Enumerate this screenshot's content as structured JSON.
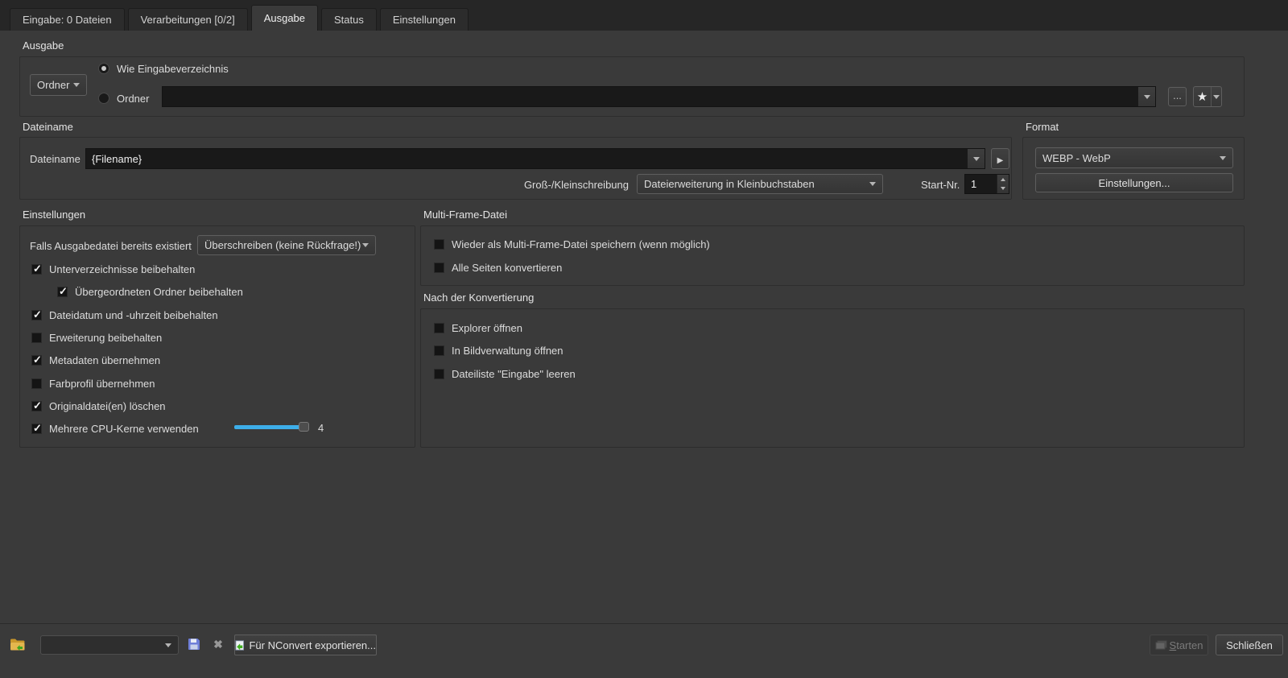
{
  "tabs": [
    {
      "label": "Eingabe: 0 Dateien"
    },
    {
      "label": "Verarbeitungen [0/2]"
    },
    {
      "label": "Ausgabe"
    },
    {
      "label": "Status"
    },
    {
      "label": "Einstellungen"
    }
  ],
  "active_tab": "Ausgabe",
  "ausgabe": {
    "title": "Ausgabe",
    "target_combo_value": "Ordner",
    "radio_same": {
      "label": "Wie Eingabeverzeichnis",
      "selected": true
    },
    "radio_folder": {
      "label": "Ordner",
      "selected": false
    },
    "folder_path_value": "",
    "browse_button": "..."
  },
  "dateiname": {
    "title": "Dateiname",
    "field_label": "Dateiname",
    "field_value": "{Filename}",
    "case_label": "Groß-/Kleinschreibung",
    "case_value": "Dateierweiterung in Kleinbuchstaben",
    "startnr_label": "Start-Nr.",
    "startnr_value": "1"
  },
  "format": {
    "title": "Format",
    "format_value": "WEBP - WebP",
    "settings_button": "Einstellungen..."
  },
  "einstellungen": {
    "title": "Einstellungen",
    "exists_label": "Falls Ausgabedatei bereits existiert",
    "exists_value": "Überschreiben (keine Rückfrage!)",
    "checkboxes": [
      {
        "label": "Unterverzeichnisse beibehalten",
        "checked": true
      },
      {
        "label": "Übergeordneten Ordner beibehalten",
        "checked": true
      },
      {
        "label": "Dateidatum und -uhrzeit beibehalten",
        "checked": true
      },
      {
        "label": "Erweiterung beibehalten",
        "checked": false
      },
      {
        "label": "Metadaten übernehmen",
        "checked": true
      },
      {
        "label": "Farbprofil übernehmen",
        "checked": false
      },
      {
        "label": "Originaldatei(en) löschen",
        "checked": true
      },
      {
        "label": "Mehrere CPU-Kerne verwenden",
        "checked": true
      }
    ],
    "cpu_slider_value": "4"
  },
  "multiframe": {
    "title": "Multi-Frame-Datei",
    "checkboxes": [
      {
        "label": "Wieder als Multi-Frame-Datei speichern (wenn möglich)",
        "checked": false
      },
      {
        "label": "Alle Seiten konvertieren",
        "checked": false
      }
    ]
  },
  "nachher": {
    "title": "Nach der Konvertierung",
    "checkboxes": [
      {
        "label": "Explorer öffnen",
        "checked": false
      },
      {
        "label": "In Bildverwaltung öffnen",
        "checked": false
      },
      {
        "label": "Dateiliste \"Eingabe\" leeren",
        "checked": false
      }
    ]
  },
  "bottom": {
    "preset_combo_value": "",
    "export_button": "Für NConvert exportieren...",
    "start_button_mnemonic": "S",
    "start_button_rest": "tarten",
    "close_button": "Schließen"
  },
  "colors": {
    "accent_blue": "#3daee9",
    "folder_yellow": "#e3b64e",
    "save_blue": "#6f7fd8",
    "export_green": "#3fae1f"
  }
}
